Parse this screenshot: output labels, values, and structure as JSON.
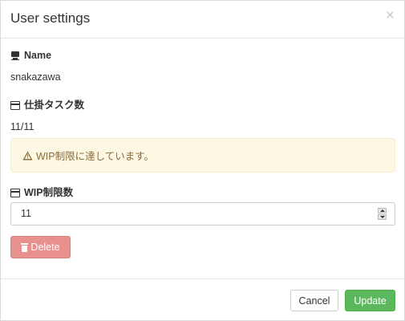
{
  "dialog": {
    "title": "User settings",
    "close_glyph": "×"
  },
  "fields": {
    "name": {
      "icon": "user-icon",
      "label": "Name",
      "value": "snakazawa"
    },
    "task_count": {
      "icon": "card-icon",
      "label": "仕掛タスク数",
      "value": "11/11"
    },
    "wip_limit": {
      "icon": "card-icon",
      "label": "WIP制限数",
      "value": "11"
    }
  },
  "alert": {
    "icon": "warning-icon",
    "text": "WIP制限に達しています。",
    "color": "#8a6d3b",
    "background": "#fcf8e3"
  },
  "buttons": {
    "delete": {
      "label": "Delete",
      "icon": "trash-icon",
      "color": "#e8908e"
    },
    "cancel": {
      "label": "Cancel"
    },
    "update": {
      "label": "Update",
      "color": "#5cb85c"
    }
  }
}
